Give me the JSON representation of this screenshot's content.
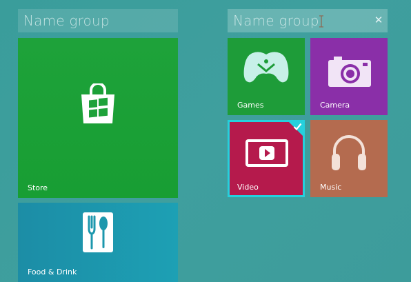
{
  "groups": [
    {
      "name_placeholder": "Name group"
    },
    {
      "name_placeholder": "Name group"
    }
  ],
  "tiles": {
    "store": {
      "label": "Store",
      "color": "#1ea23a"
    },
    "food_drink": {
      "label": "Food & Drink",
      "color": "#1c97ad"
    },
    "games": {
      "label": "Games",
      "color": "#1e9c39"
    },
    "camera": {
      "label": "Camera",
      "color": "#8a2fa8"
    },
    "video": {
      "label": "Video",
      "color": "#b51a4c",
      "selected": true
    },
    "music": {
      "label": "Music",
      "color": "#b46b4f"
    }
  },
  "icons": {
    "clear": "close-icon",
    "cursor": "text-cursor-icon",
    "selected": "checkmark-icon"
  },
  "colors": {
    "background": "#3d9c9b",
    "selection": "#25d0dd"
  }
}
